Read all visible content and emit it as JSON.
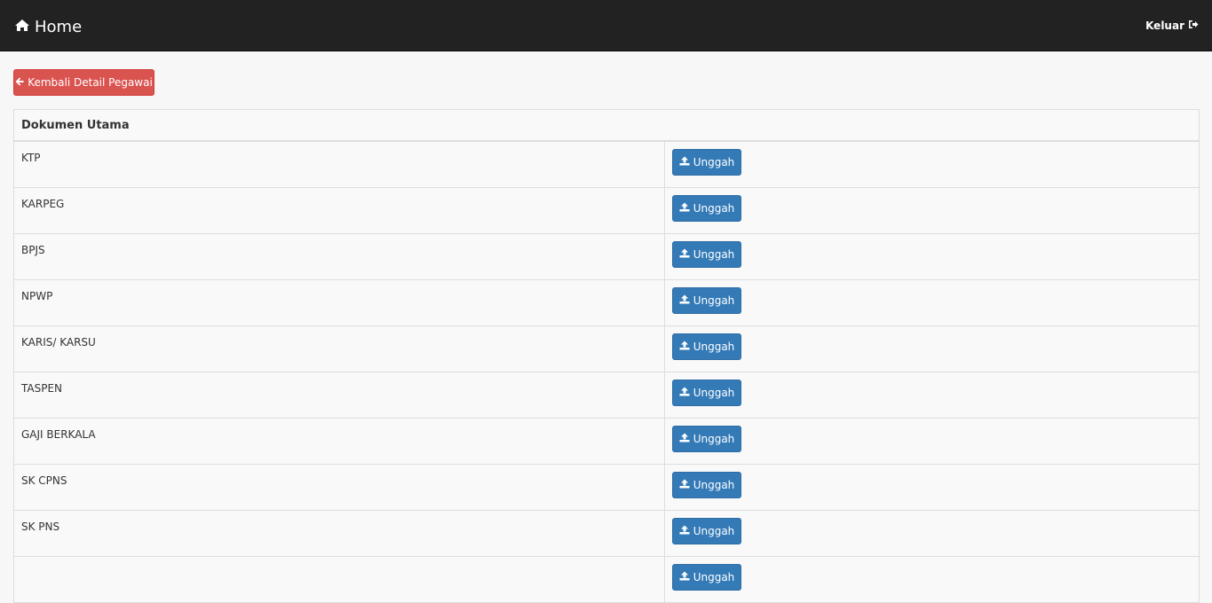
{
  "navbar": {
    "brand_label": "Home",
    "brand_icon": "home-icon",
    "logout_label": "Keluar",
    "logout_icon": "sign-out-icon"
  },
  "back_button": {
    "label": "Kembali Detail Pegawai",
    "icon": "arrow-left-icon",
    "color": "#d9534f"
  },
  "table": {
    "header": "Dokumen Utama",
    "upload_label": "Unggah",
    "upload_icon": "upload-icon",
    "upload_color": "#337ab7",
    "rows": [
      {
        "name": "KTP"
      },
      {
        "name": "KARPEG"
      },
      {
        "name": "BPJS"
      },
      {
        "name": "NPWP"
      },
      {
        "name": "KARIS/ KARSU"
      },
      {
        "name": "TASPEN"
      },
      {
        "name": "GAJI BERKALA"
      },
      {
        "name": "SK CPNS"
      },
      {
        "name": "SK PNS"
      },
      {
        "name": ""
      }
    ]
  }
}
